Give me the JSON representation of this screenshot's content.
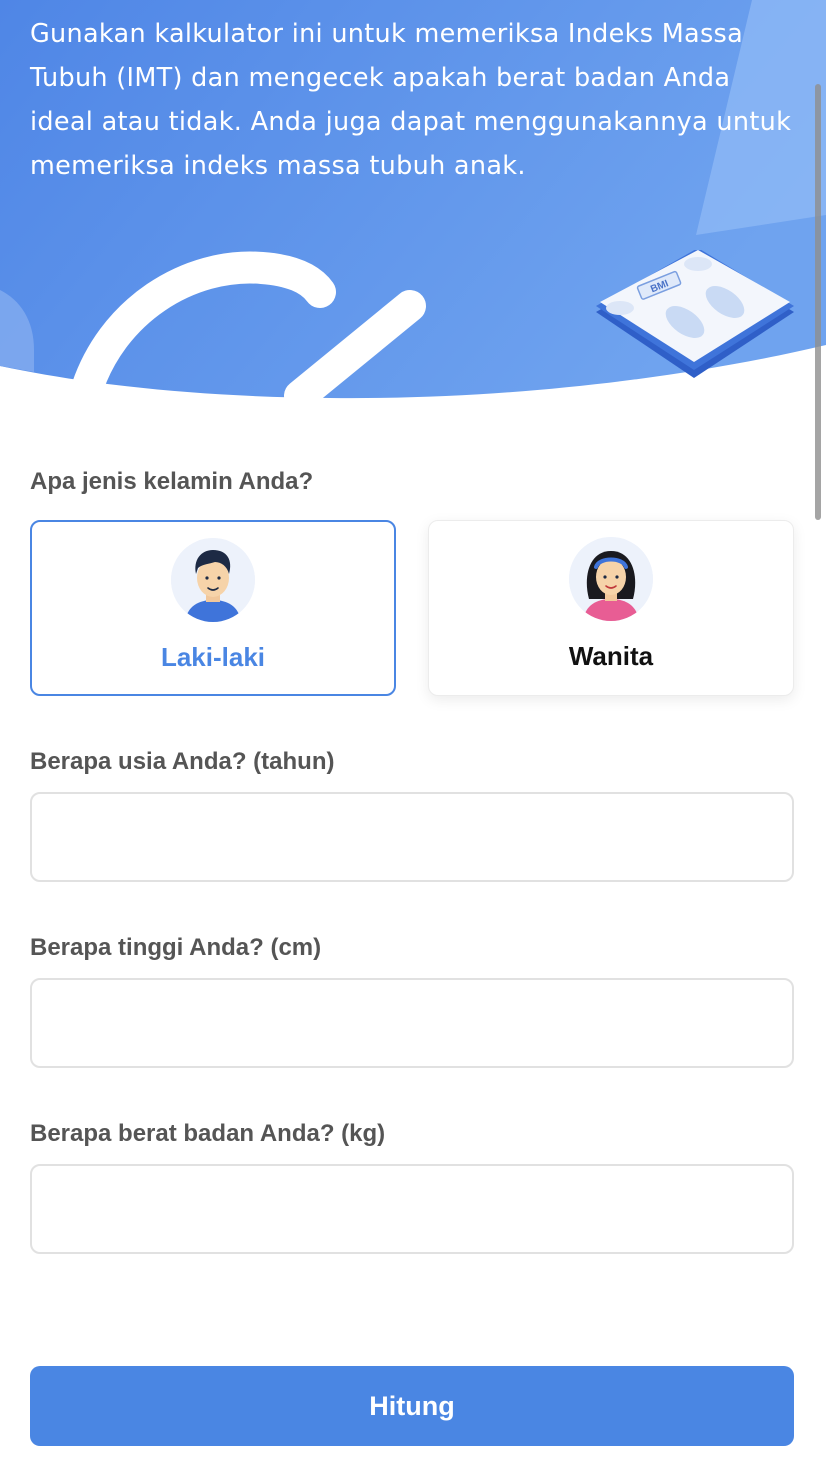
{
  "hero": {
    "description": "Gunakan kalkulator ini untuk memeriksa Indeks Massa Tubuh (IMT) dan mengecek apakah berat badan Anda ideal atau tidak. Anda juga dapat menggunakannya untuk memeriksa indeks massa tubuh anak.",
    "scale_badge": "BMI",
    "colors": {
      "gradient_start": "#4f86e6",
      "gradient_end": "#7aaef2"
    }
  },
  "form": {
    "gender_question": "Apa jenis kelamin Anda?",
    "genders": [
      {
        "label": "Laki-laki",
        "selected": true,
        "icon": "male-avatar-icon"
      },
      {
        "label": "Wanita",
        "selected": false,
        "icon": "female-avatar-icon"
      }
    ],
    "age_label": "Berapa usia Anda? (tahun)",
    "age_value": "",
    "height_label": "Berapa tinggi Anda? (cm)",
    "height_value": "",
    "weight_label": "Berapa berat badan Anda? (kg)",
    "weight_value": "",
    "submit_label": "Hitung"
  },
  "colors": {
    "accent": "#4a86e3",
    "label_text": "#555555",
    "border": "#e1e1e1"
  }
}
